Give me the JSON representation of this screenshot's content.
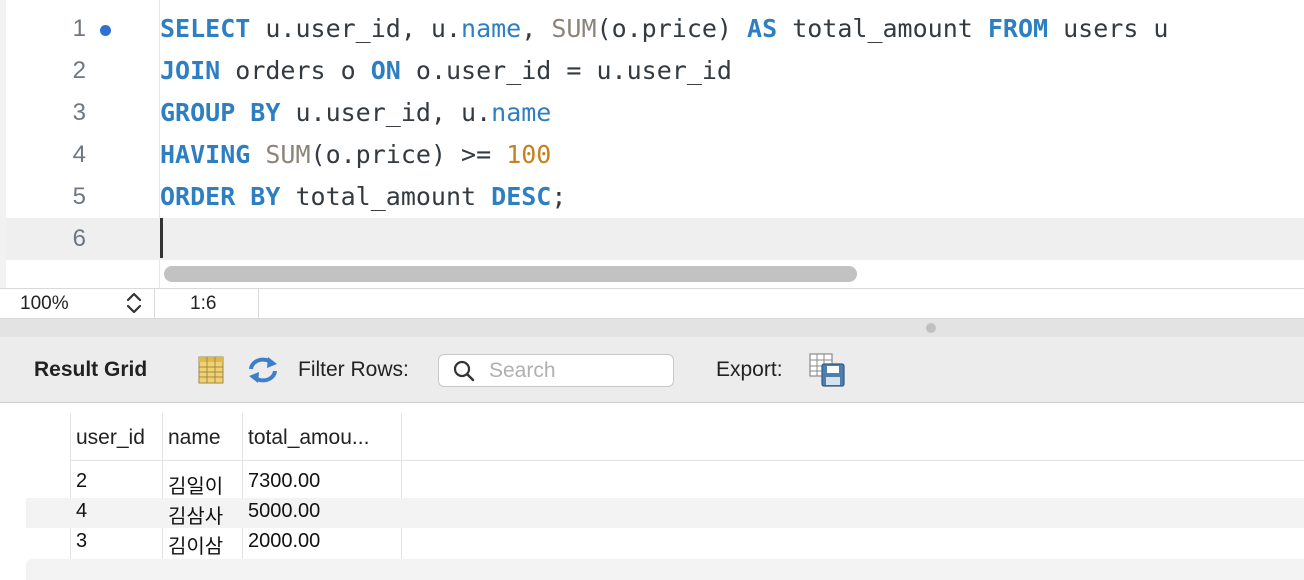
{
  "editor": {
    "line_numbers": [
      "1",
      "2",
      "3",
      "4",
      "5",
      "6"
    ],
    "lines": [
      [
        [
          "kw",
          "SELECT"
        ],
        [
          "t",
          " u.user_id, u."
        ],
        [
          "nm",
          "name"
        ],
        [
          "t",
          ", "
        ],
        [
          "fn",
          "SUM"
        ],
        [
          "t",
          "(o.price) "
        ],
        [
          "kw",
          "AS"
        ],
        [
          "t",
          " total_amount "
        ],
        [
          "kw",
          "FROM"
        ],
        [
          "t",
          " users u"
        ]
      ],
      [
        [
          "kw",
          "JOIN"
        ],
        [
          "t",
          " orders o "
        ],
        [
          "kw",
          "ON"
        ],
        [
          "t",
          " o.user_id = u.user_id"
        ]
      ],
      [
        [
          "kw",
          "GROUP BY"
        ],
        [
          "t",
          " u.user_id, u."
        ],
        [
          "nm",
          "name"
        ]
      ],
      [
        [
          "kw",
          "HAVING"
        ],
        [
          "t",
          " "
        ],
        [
          "fn",
          "SUM"
        ],
        [
          "t",
          "(o.price) >= "
        ],
        [
          "num",
          "100"
        ]
      ],
      [
        [
          "kw",
          "ORDER BY"
        ],
        [
          "t",
          " total_amount "
        ],
        [
          "kw",
          "DESC"
        ],
        [
          "t",
          ";"
        ]
      ],
      []
    ],
    "colors": {
      "keyword": "#2e7fc2",
      "function": "#8b8478",
      "number": "#c7801d",
      "text": "#333a40"
    }
  },
  "status": {
    "zoom": "100%",
    "cursor_position": "1:6"
  },
  "results": {
    "title": "Result Grid",
    "filter_label": "Filter Rows:",
    "search_placeholder": "Search",
    "export_label": "Export:",
    "columns": [
      "user_id",
      "name",
      "total_amou..."
    ],
    "rows": [
      [
        "2",
        "김일이",
        "7300.00"
      ],
      [
        "4",
        "김삼사",
        "5000.00"
      ],
      [
        "3",
        "김이삼",
        "2000.00"
      ]
    ]
  }
}
